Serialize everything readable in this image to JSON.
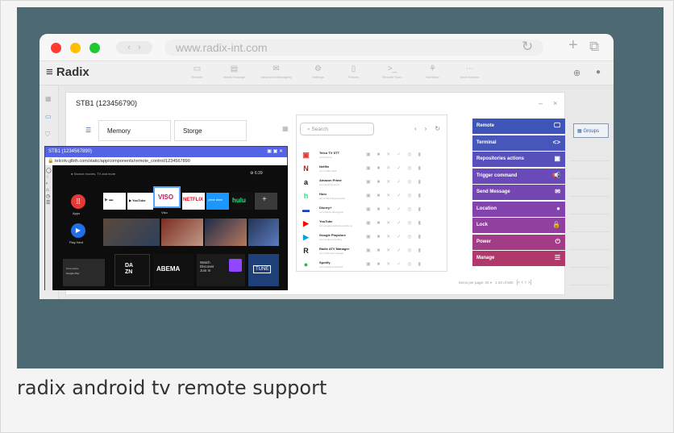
{
  "caption": "radix android tv remote support",
  "browser": {
    "url": "www.radix-int.com",
    "back": "‹",
    "forward": "›",
    "reload_icon": "reload-icon",
    "colors": {
      "close": "#ff3b30",
      "minimize": "#ffbf00",
      "maximize": "#1fc934"
    }
  },
  "app": {
    "logo": "Radix",
    "nav": [
      {
        "label": "Remote",
        "icon": "monitor-icon"
      },
      {
        "label": "Install Package",
        "icon": "package-icon"
      },
      {
        "label": "Advanced Messaging",
        "icon": "mail-icon"
      },
      {
        "label": "Settings",
        "icon": "gear-icon"
      },
      {
        "label": "Policies",
        "icon": "bookmark-icon"
      },
      {
        "label": "Remote Exec",
        "icon": "terminal-icon"
      },
      {
        "label": "Workflow",
        "icon": "workflow-icon"
      },
      {
        "label": "More Actions",
        "icon": "more-icon"
      }
    ],
    "groups_label": "Groups",
    "paging": {
      "per_page_label": "Items per page:",
      "per_page": "20",
      "range": "1-20 of 500"
    }
  },
  "dialog": {
    "title": "STB1 (123456790)",
    "minimize": "–",
    "close": "×",
    "tiles": [
      "Memory",
      "Storge"
    ],
    "search_placeholder": "Search"
  },
  "remote": {
    "title": "STB1 (1234567890)",
    "url": "telcotv.glbth.com/static/app/components/remote_control/1234567890",
    "search_hint": "Search movies, TV and more",
    "time": "6:39",
    "apps_label": "Apps",
    "play_next_label": "Play Next",
    "viso_label": "Viso",
    "channels": [
      "YouTube",
      "NETFLIX",
      "prime video",
      "hulu",
      "+"
    ],
    "dazn": "DA\nZN",
    "abema": "ABEMA",
    "twitch": "Watch\nDiscover\nJoin In",
    "tune": "TUNE",
    "promo": "Personalize",
    "google_play": "Google Play"
  },
  "apps": [
    {
      "name": "Telco TV STT",
      "sub": "com.telco.tv",
      "icon": "▣",
      "color": "#e53935"
    },
    {
      "name": "Netflix",
      "sub": "com.netflix.ninja",
      "icon": "N",
      "color": "#e50914"
    },
    {
      "name": "Amazon Prime",
      "sub": "com.amazon.avod",
      "icon": "a",
      "color": "#111"
    },
    {
      "name": "Hulu",
      "sub": "com.hulu.livingroomplus",
      "icon": "h",
      "color": "#1ce783"
    },
    {
      "name": "Disney+",
      "sub": "com.disney.disneyplus",
      "icon": "▬",
      "color": "#113ccf"
    },
    {
      "name": "YouTube",
      "sub": "com.google.android.youtube.tv",
      "icon": "▶",
      "color": "#ff0000"
    },
    {
      "name": "Google Playstore",
      "sub": "com.android.vending",
      "icon": "▶",
      "color": "#00a0e0"
    },
    {
      "name": "Radix ATV Manager",
      "sub": "com.radix.atv.manager",
      "icon": "R",
      "color": "#222"
    },
    {
      "name": "Spotify",
      "sub": "com.spotify.tv.android",
      "icon": "●",
      "color": "#1db954"
    }
  ],
  "actions": [
    {
      "label": "Remote",
      "icon": "🖵",
      "color": "#3d55b8"
    },
    {
      "label": "Terminal",
      "icon": "<>",
      "color": "#4656bb"
    },
    {
      "label": "Repositories actions",
      "icon": "▣",
      "color": "#5750bb"
    },
    {
      "label": "Trigger command",
      "icon": "📢",
      "color": "#6a4ab8"
    },
    {
      "label": "Send Message",
      "icon": "✉",
      "color": "#7547b3"
    },
    {
      "label": "Location",
      "icon": "●",
      "color": "#8343ad"
    },
    {
      "label": "Lock",
      "icon": "🔒",
      "color": "#91409f"
    },
    {
      "label": "Power",
      "icon": "⏻",
      "color": "#a23c86"
    },
    {
      "label": "Manage",
      "icon": "☰",
      "color": "#b0386a"
    }
  ]
}
